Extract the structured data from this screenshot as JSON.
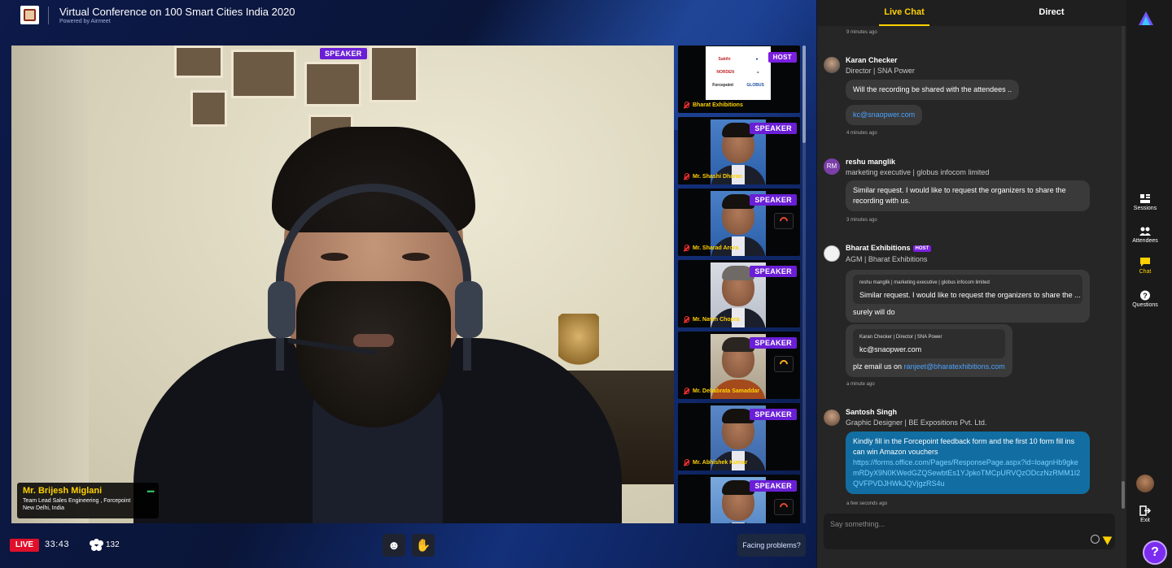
{
  "header": {
    "title": "Virtual Conference on 100 Smart Cities India 2020",
    "powered_by": "Powered by Airmeet"
  },
  "main_speaker": {
    "badge": "SPEAKER",
    "name": "Mr. Brijesh Miglani",
    "role": "Team Lead Sales Engineering , Forcepoint",
    "location": "New Delhi, India"
  },
  "tiles": [
    {
      "name": "Bharat Exhibitions",
      "badge": "HOST",
      "sponsors": [
        "Sakthi",
        "NORDEN",
        "Forcepoint",
        "GLOBUS"
      ]
    },
    {
      "name": "Mr. Shashi Dharan",
      "badge": "SPEAKER"
    },
    {
      "name": "Mr. Sharad Arora",
      "badge": "SPEAKER"
    },
    {
      "name": "Mr. Navin Chopra",
      "badge": "SPEAKER"
    },
    {
      "name": "Mr. Debabrata Samaddar",
      "badge": "SPEAKER"
    },
    {
      "name": "Mr. Abhishek Kumar",
      "badge": "SPEAKER"
    },
    {
      "name": "",
      "badge": "SPEAKER"
    }
  ],
  "bottom_bar": {
    "live": "LIVE",
    "elapsed": "33:43",
    "attendee_count": "132",
    "problems_label": "Facing problems?"
  },
  "chat": {
    "tabs": [
      "Live Chat",
      "Direct"
    ],
    "top_time": "9 minutes ago",
    "messages": [
      {
        "sender": "Karan Checker",
        "subtitle": "Director | SNA Power",
        "bubbles": [
          "Will the recording be shared with the attendees ..",
          "kc@snaopwer.com"
        ],
        "time": "4 minutes ago"
      },
      {
        "avatar": "RM",
        "sender": "reshu manglik",
        "subtitle": "marketing executive | globus infocom limited",
        "bubbles": [
          "Similar request. I would like to request the organizers to share the recording with us."
        ],
        "time": "3 minutes ago"
      },
      {
        "sender": "Bharat Exhibitions",
        "badge": "HOST",
        "subtitle": "AGM | Bharat Exhibitions",
        "replies": [
          {
            "header": "reshu manglik | marketing executive | globus infocom limited",
            "quote": "Similar request. I would like to request the organizers to share the ...",
            "text": "surely will do"
          },
          {
            "header": "Karan Checker | Director | SNA Power",
            "quote": "kc@snaopwer.com",
            "text_prefix": "plz email us on ",
            "link": "ranjeet@bharatexhibitions.com"
          }
        ],
        "time": "a minute ago"
      },
      {
        "sender": "Santosh Singh",
        "subtitle": "Graphic Designer | BE Expositions Pvt. Ltd.",
        "text": "Kindly fill in the Forcepoint feedback form and the first 10 form fill ins can win Amazon vouchers",
        "link": "https://forms.office.com/Pages/ResponsePage.aspx?id=loagnHb9gkemRDyX9N0KWedGZQSewbtEs1YJpkoTMCpURVQzODczNzRMM1I2QVFPVDJHWkJQVjgzRS4u",
        "time": "a few seconds ago"
      }
    ],
    "input_placeholder": "Say something..."
  },
  "rail": {
    "items": [
      "Sessions",
      "Attendees",
      "Chat",
      "Questions"
    ],
    "active": "Chat",
    "exit": "Exit",
    "help": "?"
  }
}
